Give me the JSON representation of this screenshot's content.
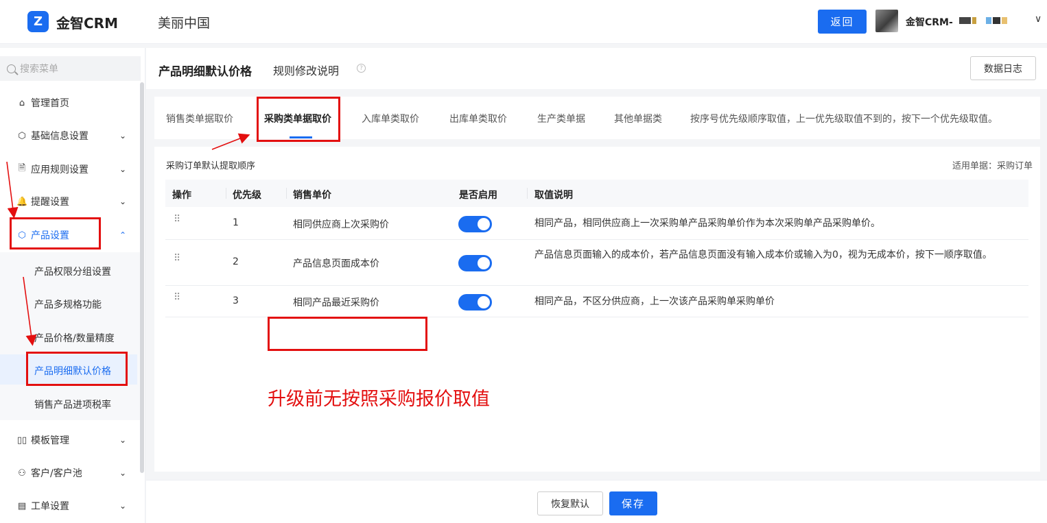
{
  "header": {
    "logo_mark": "Z",
    "logo_text": "金智CRM",
    "company": "美丽中国",
    "back_button": "返回",
    "user_name": "金智CRM-",
    "user_caret": "∨"
  },
  "sidebar": {
    "search_placeholder": "搜索菜单",
    "items": [
      {
        "label": "管理首页",
        "icon": "⌂"
      },
      {
        "label": "基础信息设置",
        "icon": "⬡",
        "chevron": "⌄"
      },
      {
        "label": "应用规则设置",
        "icon": "🗎",
        "chevron": "⌄"
      },
      {
        "label": "提醒设置",
        "icon": "🔔",
        "chevron": "⌄"
      },
      {
        "label": "产品设置",
        "icon": "⬡",
        "chevron": "⌃"
      },
      {
        "label": "模板管理",
        "icon": "▯▯",
        "chevron": "⌄"
      },
      {
        "label": "客户/客户池",
        "icon": "⚇",
        "chevron": "⌄"
      },
      {
        "label": "工单设置",
        "icon": "▤",
        "chevron": "⌄"
      }
    ],
    "sub_items": [
      "产品权限分组设置",
      "产品多规格功能",
      "产品价格/数量精度",
      "产品明细默认价格",
      "销售产品进项税率"
    ]
  },
  "main": {
    "title": "产品明细默认价格",
    "rule_link": "规则修改说明",
    "help_icon": "?",
    "log_button": "数据日志",
    "tabs": [
      "销售类单据取价",
      "采购类单据取价",
      "入库单类取价",
      "出库单类取价",
      "生产类单据",
      "其他单据类",
      "按序号优先级顺序取值，上一优先级取值不到的，按下一个优先级取值。"
    ],
    "section_title": "采购订单默认提取顺序",
    "section_right": "适用单据：采购订单",
    "table": {
      "headers": [
        "操作",
        "优先级",
        "销售单价",
        "是否启用",
        "取值说明"
      ],
      "rows": [
        {
          "drag": "⠿",
          "priority": "1",
          "price": "相同供应商上次采购价",
          "enabled": true,
          "desc": "相同产品，相同供应商上一次采购单产品采购单价作为本次采购单产品采购单价。"
        },
        {
          "drag": "⠿",
          "priority": "2",
          "price": "产品信息页面成本价",
          "enabled": true,
          "desc": "产品信息页面输入的成本价，若产品信息页面没有输入成本价或输入为0，视为无成本价，按下一顺序取值。"
        },
        {
          "drag": "⠿",
          "priority": "3",
          "price": "相同产品最近采购价",
          "enabled": true,
          "desc": "相同产品，不区分供应商，上一次该产品采购单采购单价"
        }
      ]
    }
  },
  "footer": {
    "reset_button": "恢复默认",
    "save_button": "保存"
  },
  "annotation": {
    "text": "升级前无按照采购报价取值",
    "color": "#e30f0f"
  },
  "colors": {
    "primary": "#1a6cf0",
    "annotation": "#e30f0f"
  }
}
